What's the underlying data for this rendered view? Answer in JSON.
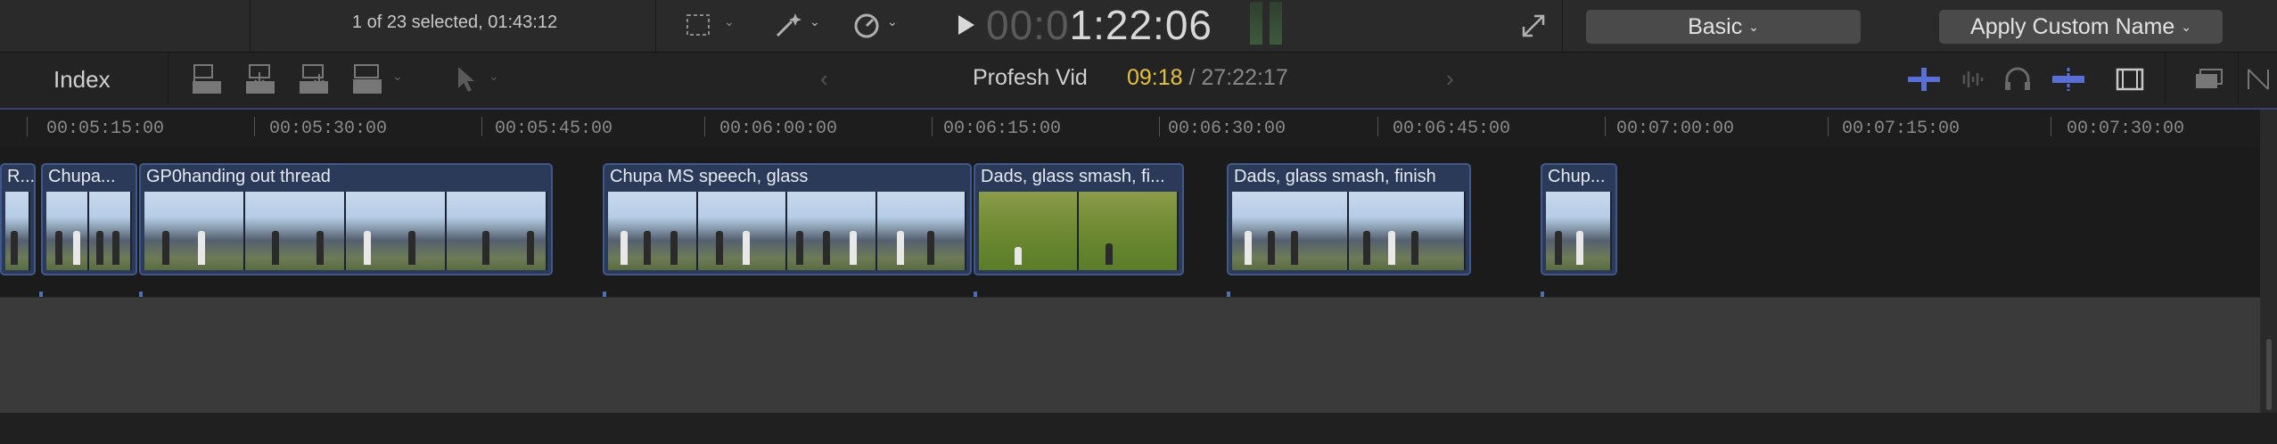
{
  "toolbar": {
    "selection_info": "1 of 23 selected, 01:43:12",
    "timecode_dim": "00:0",
    "timecode_lit": "1:22:06",
    "workspace_label": "Basic",
    "action_label": "Apply Custom Name",
    "chevron": "⌄"
  },
  "timeline_bar": {
    "index_label": "Index",
    "project_name": "Profesh Vid",
    "current_time": "09:18",
    "total_time": "/ 27:22:17"
  },
  "ruler": {
    "labels": [
      "00:05:15:00",
      "00:05:30:00",
      "00:05:45:00",
      "00:06:00:00",
      "00:06:15:00",
      "00:06:30:00",
      "00:06:45:00",
      "00:07:00:00",
      "00:07:15:00",
      "00:07:30:00"
    ]
  },
  "clips": [
    {
      "title": "R..."
    },
    {
      "title": "Chupa..."
    },
    {
      "title": "GP0handing out thread"
    },
    {
      "title": "Chupa MS speech, glass"
    },
    {
      "title": "Dads, glass smash, fi..."
    },
    {
      "title": "Dads, glass smash, finish"
    },
    {
      "title": "Chup..."
    }
  ],
  "colors": {
    "accent_time": "#e7c23a",
    "clip_fill": "#2a3a58",
    "clip_border": "#41588a",
    "playhead_line": "#3a3f72"
  },
  "icons": [
    "transform-icon",
    "magic-wand-icon",
    "speed-icon",
    "play-icon",
    "fullscreen-icon",
    "append-clip-icon",
    "insert-clip-icon",
    "connect-clip-icon",
    "overwrite-clip-icon",
    "select-arrow-icon",
    "audio-skimming-icon",
    "waveform-icon",
    "headphones-icon",
    "snapping-icon",
    "clip-appearance-icon",
    "browser-toggle-icon",
    "inspector-toggle-icon"
  ]
}
